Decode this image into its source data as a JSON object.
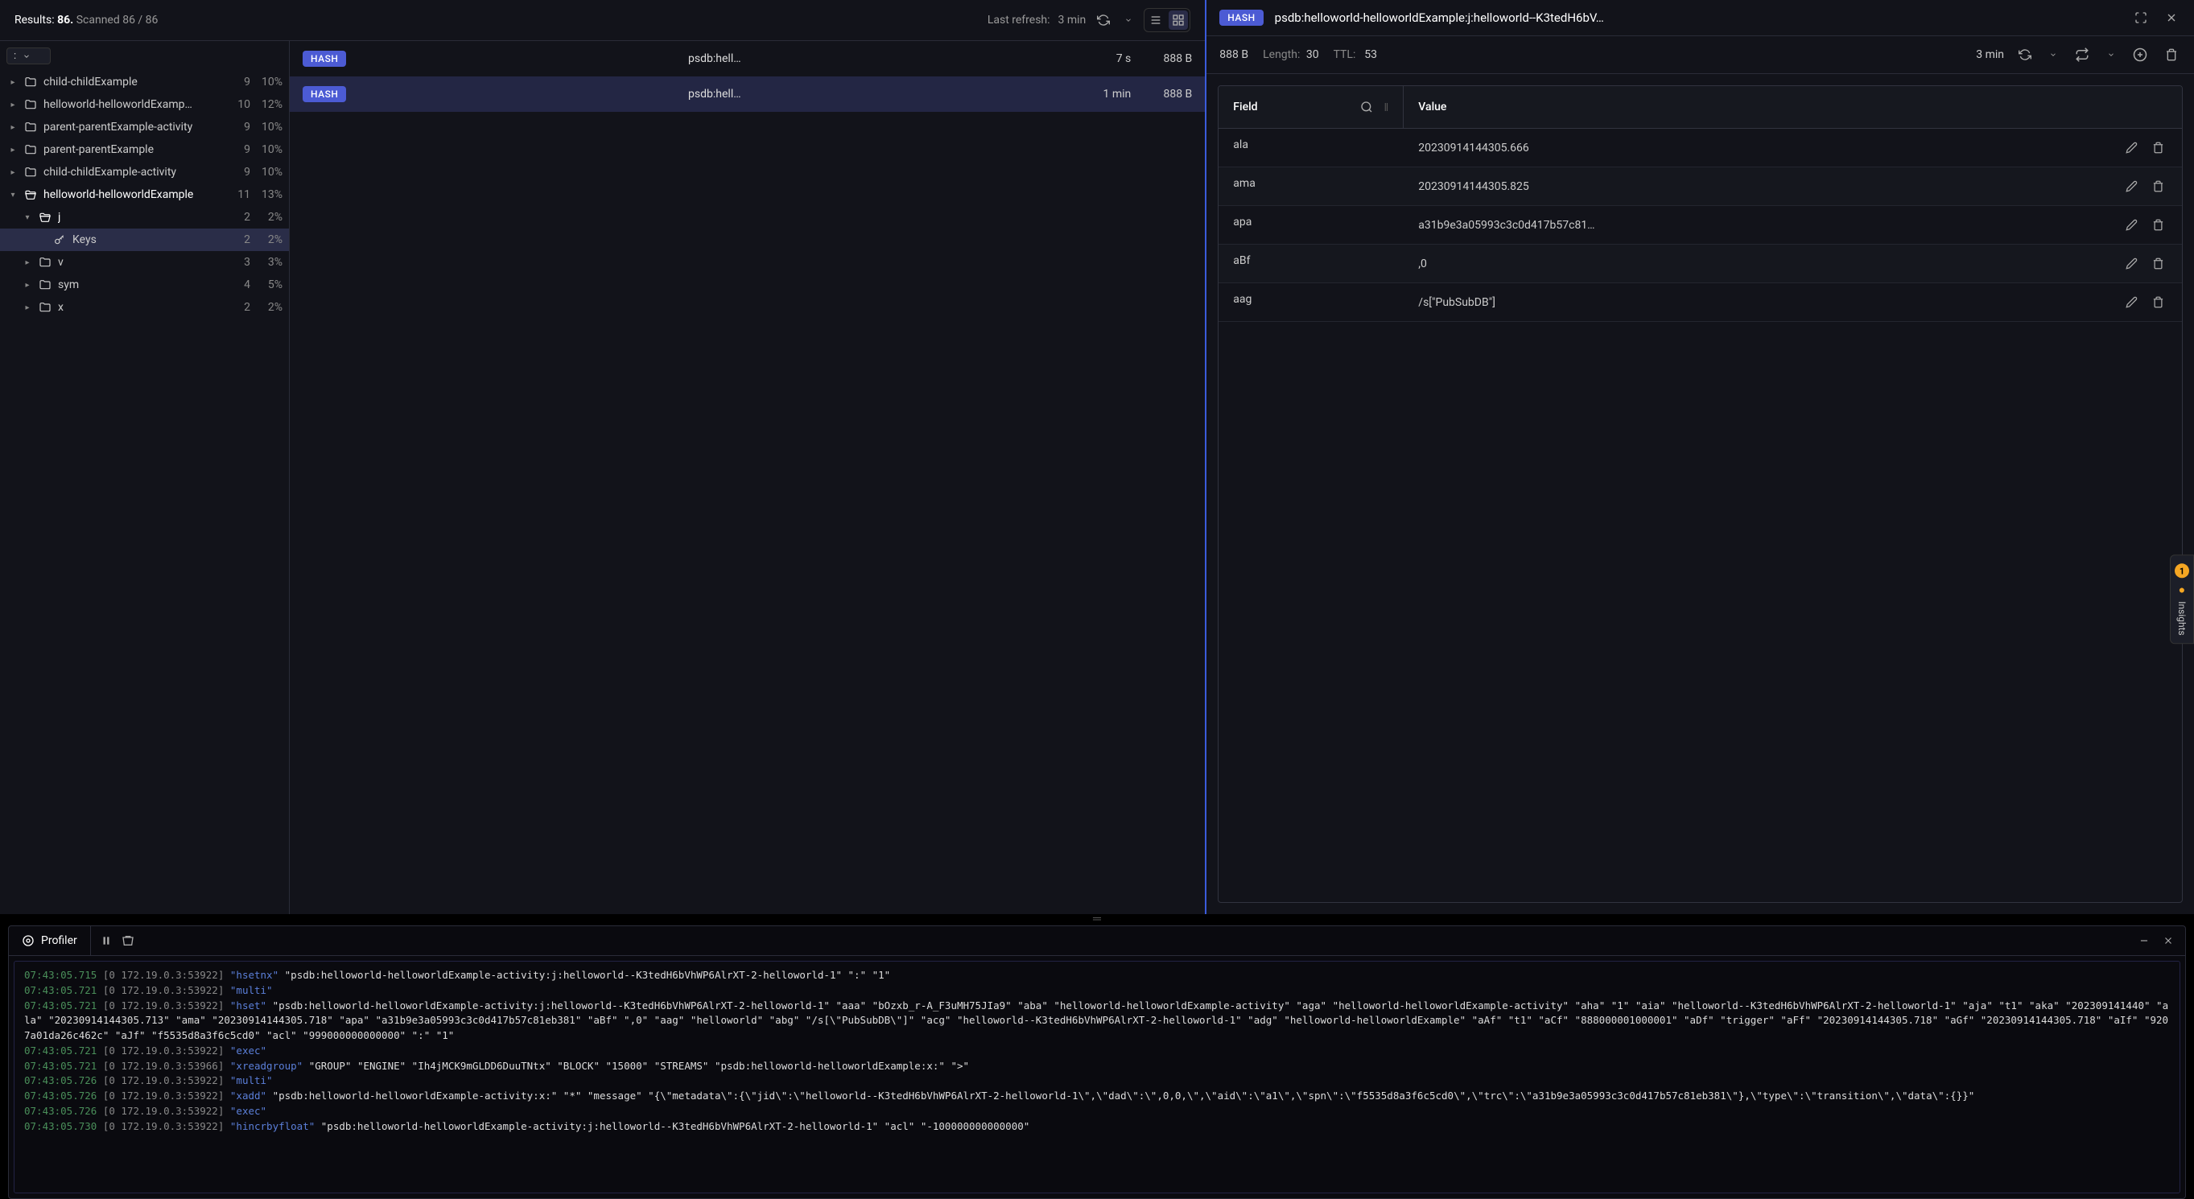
{
  "results": {
    "label": "Results:",
    "count": "86.",
    "scanned": "Scanned 86 / 86",
    "last_refresh_label": "Last refresh:",
    "last_refresh_value": "3 min"
  },
  "filter_value": ":",
  "tree": [
    {
      "label": "child-childExample",
      "count": "9",
      "pct": "10%",
      "indent": 0,
      "expanded": false,
      "type": "folder"
    },
    {
      "label": "helloworld-helloworldExamp…",
      "count": "10",
      "pct": "12%",
      "indent": 0,
      "expanded": false,
      "type": "folder"
    },
    {
      "label": "parent-parentExample-activity",
      "count": "9",
      "pct": "10%",
      "indent": 0,
      "expanded": false,
      "type": "folder"
    },
    {
      "label": "parent-parentExample",
      "count": "9",
      "pct": "10%",
      "indent": 0,
      "expanded": false,
      "type": "folder"
    },
    {
      "label": "child-childExample-activity",
      "count": "9",
      "pct": "10%",
      "indent": 0,
      "expanded": false,
      "type": "folder"
    },
    {
      "label": "helloworld-helloworldExample",
      "count": "11",
      "pct": "13%",
      "indent": 0,
      "expanded": true,
      "type": "folder-open"
    },
    {
      "label": "j",
      "count": "2",
      "pct": "2%",
      "indent": 1,
      "expanded": true,
      "type": "folder-open"
    },
    {
      "label": "Keys",
      "count": "2",
      "pct": "2%",
      "indent": 2,
      "expanded": false,
      "type": "keys",
      "selected": true
    },
    {
      "label": "v",
      "count": "3",
      "pct": "3%",
      "indent": 1,
      "expanded": false,
      "type": "folder"
    },
    {
      "label": "sym",
      "count": "4",
      "pct": "5%",
      "indent": 1,
      "expanded": false,
      "type": "folder"
    },
    {
      "label": "x",
      "count": "2",
      "pct": "2%",
      "indent": 1,
      "expanded": false,
      "type": "folder"
    }
  ],
  "keys": [
    {
      "type": "HASH",
      "name": "psdb:hell…",
      "ttl": "7 s",
      "size": "888 B",
      "selected": false
    },
    {
      "type": "HASH",
      "name": "psdb:hell…",
      "ttl": "1 min",
      "size": "888 B",
      "selected": true
    }
  ],
  "detail": {
    "type": "HASH",
    "title": "psdb:helloworld-helloworldExample:j:helloworld--K3tedH6bV…",
    "size": "888 B",
    "length_label": "Length:",
    "length": "30",
    "ttl_label": "TTL:",
    "ttl": "53",
    "age": "3 min",
    "field_header": "Field",
    "value_header": "Value",
    "rows": [
      {
        "field": "ala",
        "value": "20230914144305.666"
      },
      {
        "field": "ama",
        "value": "20230914144305.825"
      },
      {
        "field": "apa",
        "value": "a31b9e3a05993c3c0d417b57c81…"
      },
      {
        "field": "aBf",
        "value": ",0"
      },
      {
        "field": "aag",
        "value": "/s[\"PubSubDB\"]"
      }
    ]
  },
  "profiler": {
    "tab_label": "Profiler",
    "lines": [
      {
        "ts": "07:43:05.715",
        "src": "[0 172.19.0.3:53922]",
        "cmd": "\"hsetnx\"",
        "rest": "\"psdb:helloworld-helloworldExample-activity:j:helloworld--K3tedH6bVhWP6AlrXT-2-helloworld-1\" \":\" \"1\""
      },
      {
        "ts": "07:43:05.721",
        "src": "[0 172.19.0.3:53922]",
        "cmd": "\"multi\"",
        "rest": ""
      },
      {
        "ts": "07:43:05.721",
        "src": "[0 172.19.0.3:53922]",
        "cmd": "\"hset\"",
        "rest": "\"psdb:helloworld-helloworldExample-activity:j:helloworld--K3tedH6bVhWP6AlrXT-2-helloworld-1\" \"aaa\" \"bOzxb_r-A_F3uMH75JIa9\" \"aba\" \"helloworld-helloworldExample-activity\" \"aga\" \"helloworld-helloworldExample-activity\" \"aha\" \"1\" \"aia\" \"helloworld--K3tedH6bVhWP6AlrXT-2-helloworld-1\" \"aja\" \"t1\" \"aka\" \"202309141440\" \"ala\" \"20230914144305.713\" \"ama\" \"20230914144305.718\" \"apa\" \"a31b9e3a05993c3c0d417b57c81eb381\" \"aBf\" \",0\" \"aag\" \"helloworld\" \"abg\" \"/s[\\\"PubSubDB\\\"]\" \"acg\" \"helloworld--K3tedH6bVhWP6AlrXT-2-helloworld-1\" \"adg\" \"helloworld-helloworldExample\" \"aAf\" \"t1\" \"aCf\" \"888000001000001\" \"aDf\" \"trigger\" \"aFf\" \"20230914144305.718\" \"aGf\" \"20230914144305.718\" \"aIf\" \"9207a01da26c462c\" \"aJf\" \"f5535d8a3f6c5cd0\" \"acl\" \"999000000000000\" \":\" \"1\""
      },
      {
        "ts": "07:43:05.721",
        "src": "[0 172.19.0.3:53922]",
        "cmd": "\"exec\"",
        "rest": ""
      },
      {
        "ts": "07:43:05.721",
        "src": "[0 172.19.0.3:53966]",
        "cmd": "\"xreadgroup\"",
        "rest": "\"GROUP\" \"ENGINE\" \"Ih4jMCK9mGLDD6DuuTNtx\" \"BLOCK\" \"15000\" \"STREAMS\" \"psdb:helloworld-helloworldExample:x:\" \">\""
      },
      {
        "ts": "07:43:05.726",
        "src": "[0 172.19.0.3:53922]",
        "cmd": "\"multi\"",
        "rest": ""
      },
      {
        "ts": "07:43:05.726",
        "src": "[0 172.19.0.3:53922]",
        "cmd": "\"xadd\"",
        "rest": "\"psdb:helloworld-helloworldExample-activity:x:\" \"*\" \"message\" \"{\\\"metadata\\\":{\\\"jid\\\":\\\"helloworld--K3tedH6bVhWP6AlrXT-2-helloworld-1\\\",\\\"dad\\\":\\\",0,0,\\\",\\\"aid\\\":\\\"a1\\\",\\\"spn\\\":\\\"f5535d8a3f6c5cd0\\\",\\\"trc\\\":\\\"a31b9e3a05993c3c0d417b57c81eb381\\\"},\\\"type\\\":\\\"transition\\\",\\\"data\\\":{}}\""
      },
      {
        "ts": "07:43:05.726",
        "src": "[0 172.19.0.3:53922]",
        "cmd": "\"exec\"",
        "rest": ""
      },
      {
        "ts": "07:43:05.730",
        "src": "[0 172.19.0.3:53922]",
        "cmd": "\"hincrbyfloat\"",
        "rest": "\"psdb:helloworld-helloworldExample-activity:j:helloworld--K3tedH6bVhWP6AlrXT-2-helloworld-1\" \"acl\" \"-100000000000000\""
      }
    ]
  },
  "insights": {
    "badge": "1",
    "label": "Insights"
  }
}
